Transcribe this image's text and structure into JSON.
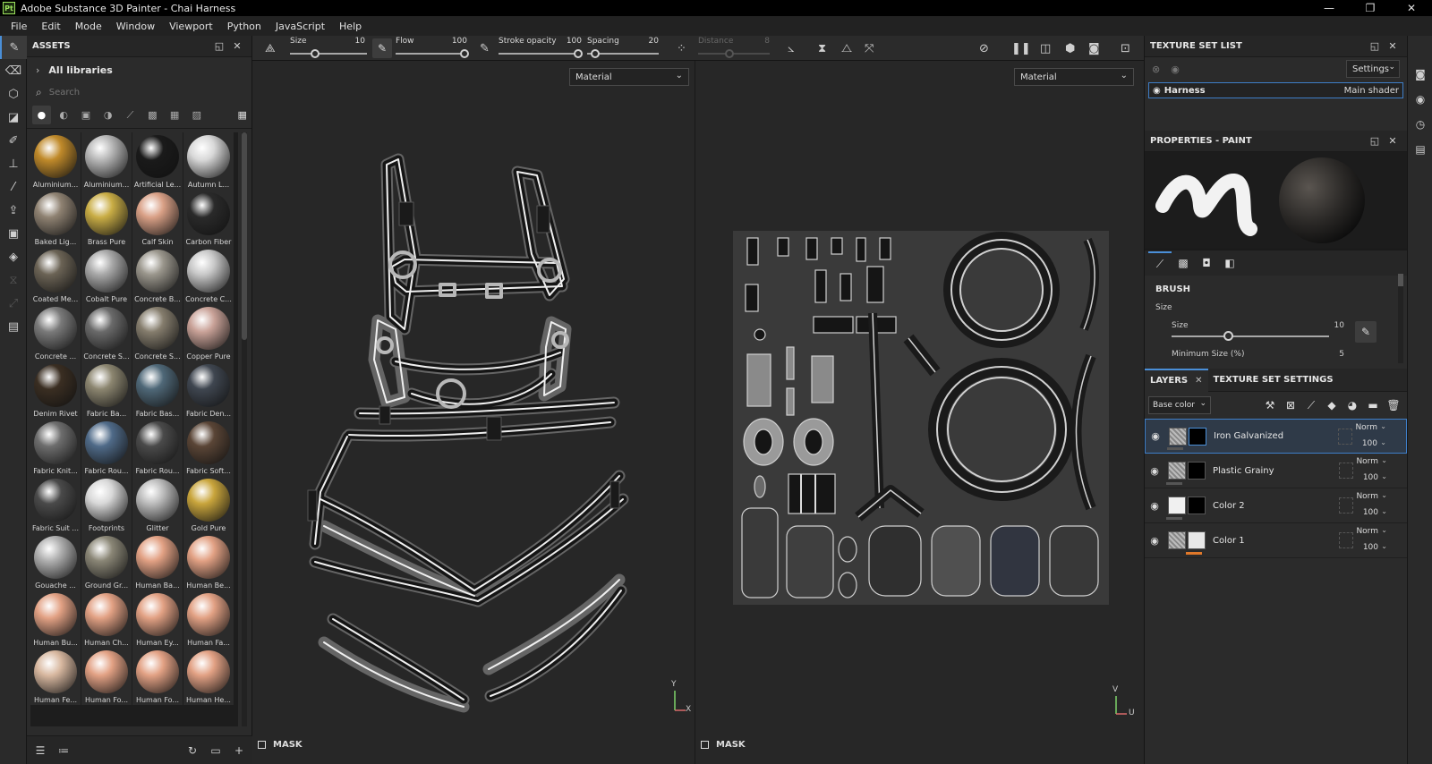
{
  "app": {
    "badge": "Pt",
    "title": "Adobe Substance 3D Painter - Chai Harness",
    "controls": [
      "—",
      "❐",
      "✕"
    ]
  },
  "menu": [
    "File",
    "Edit",
    "Mode",
    "Window",
    "Viewport",
    "Python",
    "JavaScript",
    "Help"
  ],
  "assets": {
    "title": "ASSETS",
    "library": "All libraries",
    "search_placeholder": "Search",
    "items": [
      {
        "label": "Aluminium...",
        "color": "#c08a2a"
      },
      {
        "label": "Aluminium...",
        "color": "#b8b8b8"
      },
      {
        "label": "Artificial Le...",
        "color": "#1a1a1a"
      },
      {
        "label": "Autumn L...",
        "color": "#d8d8d8"
      },
      {
        "label": "Baked Lig...",
        "color": "#8f8272"
      },
      {
        "label": "Brass Pure",
        "color": "#c9ad45"
      },
      {
        "label": "Calf Skin",
        "color": "#d9a086"
      },
      {
        "label": "Carbon Fiber",
        "color": "#2a2a2a"
      },
      {
        "label": "Coated Me...",
        "color": "#6b6355"
      },
      {
        "label": "Cobalt Pure",
        "color": "#a8a8a8"
      },
      {
        "label": "Concrete B...",
        "color": "#9a968c"
      },
      {
        "label": "Concrete C...",
        "color": "#c8c8c8"
      },
      {
        "label": "Concrete ...",
        "color": "#7a7a7a"
      },
      {
        "label": "Concrete S...",
        "color": "#6a6a6a"
      },
      {
        "label": "Concrete S...",
        "color": "#857d6d"
      },
      {
        "label": "Copper Pure",
        "color": "#c9a298"
      },
      {
        "label": "Denim Rivet",
        "color": "#3a2e22"
      },
      {
        "label": "Fabric Ba...",
        "color": "#8c8670"
      },
      {
        "label": "Fabric Bas...",
        "color": "#4f6878"
      },
      {
        "label": "Fabric Den...",
        "color": "#3f4650"
      },
      {
        "label": "Fabric Knit...",
        "color": "#6d6d6d"
      },
      {
        "label": "Fabric Rou...",
        "color": "#4f6a88"
      },
      {
        "label": "Fabric Rou...",
        "color": "#4a4a4a"
      },
      {
        "label": "Fabric Soft...",
        "color": "#5a4536"
      },
      {
        "label": "Fabric Suit ...",
        "color": "#4a4a4a"
      },
      {
        "label": "Footprints",
        "color": "#d8d8d8"
      },
      {
        "label": "Glitter",
        "color": "#bcbcbc"
      },
      {
        "label": "Gold Pure",
        "color": "#c9a53c"
      },
      {
        "label": "Gouache ...",
        "color": "#b0b0b0"
      },
      {
        "label": "Ground Gr...",
        "color": "#8a8676"
      },
      {
        "label": "Human Ba...",
        "color": "#e2a184"
      },
      {
        "label": "Human Be...",
        "color": "#e2a184"
      },
      {
        "label": "Human Bu...",
        "color": "#e2a184"
      },
      {
        "label": "Human Ch...",
        "color": "#e2a184"
      },
      {
        "label": "Human Ey...",
        "color": "#e2a184"
      },
      {
        "label": "Human Fa...",
        "color": "#e2a184"
      },
      {
        "label": "Human Fe...",
        "color": "#d8b8a0"
      },
      {
        "label": "Human Fo...",
        "color": "#e2a184"
      },
      {
        "label": "Human Fo...",
        "color": "#e2a184"
      },
      {
        "label": "Human He...",
        "color": "#e2a184"
      }
    ]
  },
  "toolbar": {
    "size_label": "Size",
    "size_value": "10",
    "flow_label": "Flow",
    "flow_value": "100",
    "opacity_label": "Stroke opacity",
    "opacity_value": "100",
    "spacing_label": "Spacing",
    "spacing_value": "20",
    "distance_label": "Distance",
    "distance_value": "8"
  },
  "viewports": {
    "left_channel": "Material",
    "right_channel": "Material",
    "mask_label": "MASK",
    "axis_left": [
      "Y",
      "X"
    ],
    "axis_right": [
      "V",
      "U"
    ]
  },
  "texture_set_list": {
    "title": "TEXTURE SET LIST",
    "settings": "Settings",
    "set_name": "Harness",
    "shader": "Main shader"
  },
  "properties": {
    "title": "PROPERTIES - PAINT",
    "section": "BRUSH",
    "group": "Size",
    "size_label": "Size",
    "size_value": "10",
    "minsize_label": "Minimum Size (%)",
    "minsize_value": "5"
  },
  "layers": {
    "tab": "LAYERS",
    "tab2": "TEXTURE SET SETTINGS",
    "channel": "Base color",
    "rows": [
      {
        "name": "Iron Galvanized",
        "blend": "Norm",
        "opacity": "100"
      },
      {
        "name": "Plastic Grainy",
        "blend": "Norm",
        "opacity": "100"
      },
      {
        "name": "Color 2",
        "blend": "Norm",
        "opacity": "100"
      },
      {
        "name": "Color 1",
        "blend": "Norm",
        "opacity": "100"
      }
    ]
  }
}
